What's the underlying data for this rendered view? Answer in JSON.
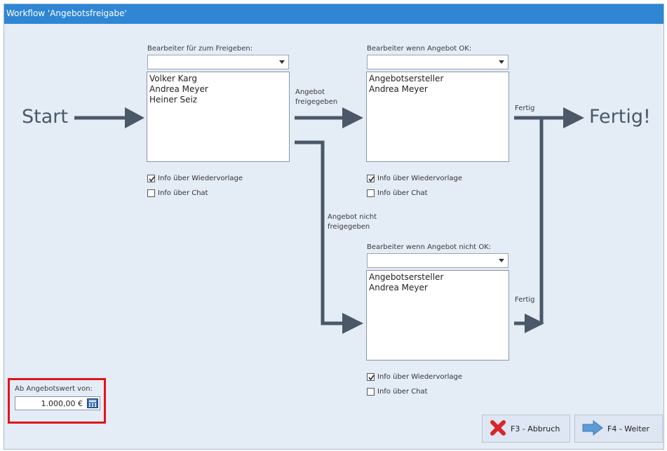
{
  "window": {
    "title": "Workflow 'Angebotsfreigabe'"
  },
  "flow": {
    "start_label": "Start",
    "end_label": "Fertig!",
    "approved_label_1": "Angebot",
    "approved_label_2": "freigegeben",
    "not_approved_label_1": "Angebot nicht",
    "not_approved_label_2": "freigegeben",
    "done_label_top": "Fertig",
    "done_label_bottom": "Fertig"
  },
  "panels": {
    "approval": {
      "label": "Bearbeiter für zum Freigeben:",
      "combo_value": "",
      "items": [
        "Volker Karg",
        "Andrea Meyer",
        "Heiner Seiz"
      ],
      "info_wiedervorlage": "Info über Wiedervorlage",
      "info_chat": "Info über Chat",
      "wiedervorlage_checked": true,
      "chat_checked": false
    },
    "ok": {
      "label": "Bearbeiter wenn Angebot OK:",
      "combo_value": "",
      "items": [
        "Angebotsersteller",
        "Andrea Meyer"
      ],
      "info_wiedervorlage": "Info über Wiedervorlage",
      "info_chat": "Info über Chat",
      "wiedervorlage_checked": true,
      "chat_checked": false
    },
    "not_ok": {
      "label": "Bearbeiter wenn Angebot nicht OK:",
      "combo_value": "",
      "items": [
        "Angebotsersteller",
        "Andrea Meyer"
      ],
      "info_wiedervorlage": "Info über Wiedervorlage",
      "info_chat": "Info über Chat",
      "wiedervorlage_checked": true,
      "chat_checked": false
    }
  },
  "threshold": {
    "label": "Ab Angebotswert von:",
    "value": "1.000,00 €",
    "calc_icon": "calculator-icon"
  },
  "buttons": {
    "cancel_label": "F3 - Abbruch",
    "next_label": "F4 - Weiter",
    "cancel_icon": "red-x-icon",
    "next_icon": "right-arrow-icon"
  },
  "colors": {
    "titlebar": "#2f86d4",
    "background": "#e4ecf6",
    "arrow": "#4a5868",
    "highlight_frame": "#e1141a"
  }
}
